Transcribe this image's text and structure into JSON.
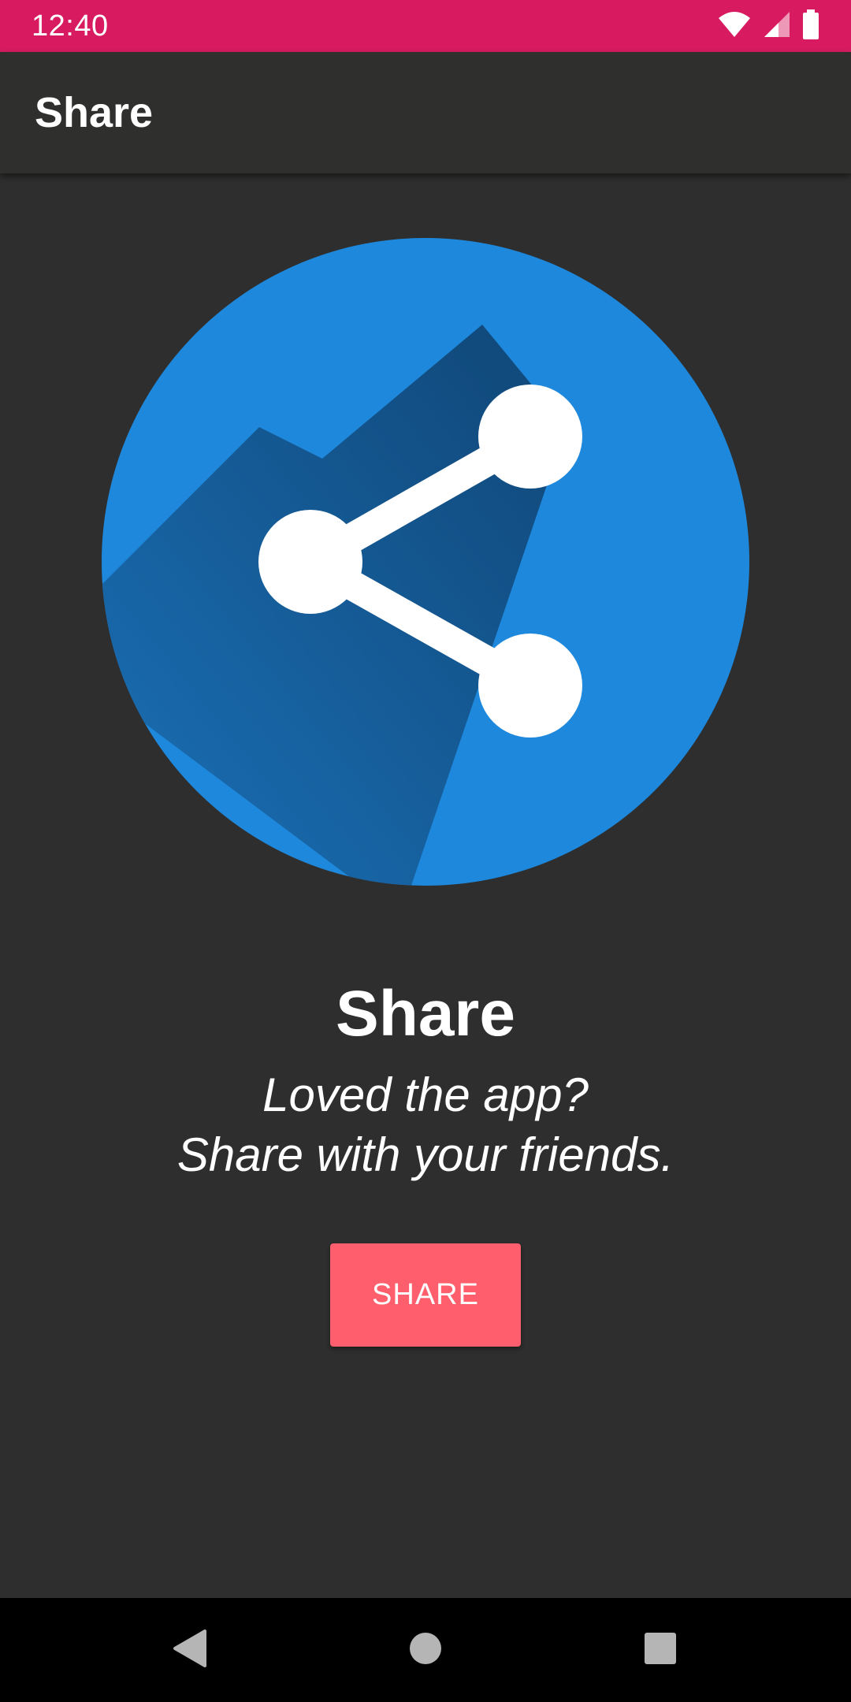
{
  "status_bar": {
    "time": "12:40",
    "icons": [
      "wifi-icon",
      "cell-signal-icon",
      "battery-icon"
    ],
    "background_color": "#d81b60"
  },
  "app_bar": {
    "title": "Share",
    "background_color": "#2f2f2d"
  },
  "hero": {
    "icon": "share-icon",
    "circle_color": "#1e88dc",
    "shadow_color": "#124a78"
  },
  "content": {
    "headline": "Share",
    "subtitle_line1": "Loved the app?",
    "subtitle_line2": "Share with your friends."
  },
  "share_button": {
    "label": "SHARE",
    "color": "#ff5f6d"
  },
  "nav_bar": {
    "buttons": [
      "back-icon",
      "home-icon",
      "recents-icon"
    ]
  }
}
